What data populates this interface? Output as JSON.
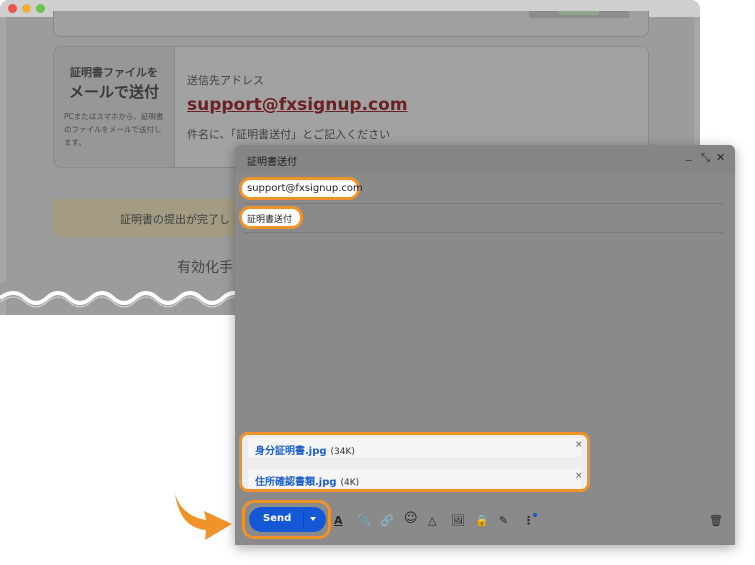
{
  "page": {
    "certificate": {
      "left_title": "証明書ファイルを",
      "left_heading": "メールで送付",
      "left_desc": "PCまたはスマホから、証明書のファイルをメールで送付します。",
      "to_label": "送信先アドレス",
      "email": "support@fxsignup.com",
      "note": "件名に、「証明書送付」とご記入ください"
    },
    "banner_text": "証明書の提出が完了し",
    "sub_heading": "有効化手"
  },
  "compose": {
    "title": "証明書送付",
    "minimize_icon": "_",
    "expand_icon": "⤡",
    "close_icon": "✕",
    "to": "support@fxsignup.com",
    "subject": "証明書送付",
    "attachments": [
      {
        "name": "身分証明書.jpg",
        "size": "(34K)"
      },
      {
        "name": "住所確認書類.jpg",
        "size": "(4K)"
      }
    ],
    "remove_icon": "×",
    "send_label": "Send",
    "toolbar": {
      "format": "A",
      "attach": "📎",
      "link": "🔗",
      "emoji": "☺",
      "drive": "△",
      "photo": "🖼",
      "confidential": "🔒",
      "signature": "✎",
      "more": "⋮",
      "delete": "🗑"
    }
  },
  "colors": {
    "accent_highlight": "#f0922a",
    "send_button": "#1558d6",
    "link_email": "#6e1f24",
    "attachment_link": "#1e60c8"
  }
}
